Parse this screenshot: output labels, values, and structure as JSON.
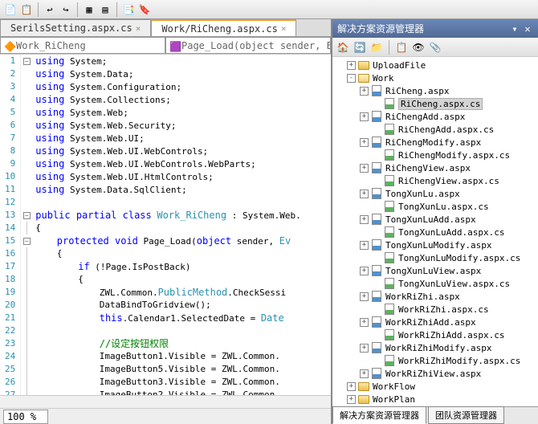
{
  "tabs": [
    {
      "label": "SerilsSetting.aspx.cs",
      "active": false
    },
    {
      "label": "Work/RiCheng.aspx.cs",
      "active": true
    }
  ],
  "dropdowns": {
    "left": "Work_RiCheng",
    "right": "Page_Load(object sender, Ev"
  },
  "code": [
    {
      "n": 1,
      "fold": "minus",
      "html": "<span class='kw'>using</span> System;"
    },
    {
      "n": 2,
      "fold": "",
      "html": "<span class='kw'>using</span> System.Data;"
    },
    {
      "n": 3,
      "fold": "",
      "html": "<span class='kw'>using</span> System.Configuration;"
    },
    {
      "n": 4,
      "fold": "",
      "html": "<span class='kw'>using</span> System.Collections;"
    },
    {
      "n": 5,
      "fold": "",
      "html": "<span class='kw'>using</span> System.Web;"
    },
    {
      "n": 6,
      "fold": "",
      "html": "<span class='kw'>using</span> System.Web.Security;"
    },
    {
      "n": 7,
      "fold": "",
      "html": "<span class='kw'>using</span> System.Web.UI;"
    },
    {
      "n": 8,
      "fold": "",
      "html": "<span class='kw'>using</span> System.Web.UI.WebControls;"
    },
    {
      "n": 9,
      "fold": "",
      "html": "<span class='kw'>using</span> System.Web.UI.WebControls.WebParts;"
    },
    {
      "n": 10,
      "fold": "",
      "html": "<span class='kw'>using</span> System.Web.UI.HtmlControls;"
    },
    {
      "n": 11,
      "fold": "",
      "html": "<span class='kw'>using</span> System.Data.SqlClient;"
    },
    {
      "n": 12,
      "fold": "",
      "html": ""
    },
    {
      "n": 13,
      "fold": "minus",
      "html": "<span class='kw'>public partial class</span> <span class='typ'>Work_RiCheng</span> : System.Web."
    },
    {
      "n": 14,
      "fold": "line",
      "html": "{"
    },
    {
      "n": 15,
      "fold": "minus",
      "html": "    <span class='kw'>protected void</span> Page_Load(<span class='kw'>object</span> sender, <span class='typ'>Ev</span>"
    },
    {
      "n": 16,
      "fold": "line",
      "html": "    {"
    },
    {
      "n": 17,
      "fold": "line",
      "html": "        <span class='kw'>if</span> (!Page.IsPostBack)"
    },
    {
      "n": 18,
      "fold": "line",
      "html": "        {"
    },
    {
      "n": 19,
      "fold": "line",
      "html": "            ZWL.Common.<span class='typ'>PublicMethod</span>.CheckSessi"
    },
    {
      "n": 20,
      "fold": "line",
      "html": "            DataBindToGridview();"
    },
    {
      "n": 21,
      "fold": "line",
      "html": "            <span class='kw'>this</span>.Calendar1.SelectedDate = <span class='typ'>Date</span>"
    },
    {
      "n": 22,
      "fold": "line",
      "html": ""
    },
    {
      "n": 23,
      "fold": "line",
      "html": "            <span class='cmt'>//设定按钮权限</span>"
    },
    {
      "n": 24,
      "fold": "line",
      "html": "            ImageButton1.Visible = ZWL.Common."
    },
    {
      "n": 25,
      "fold": "line",
      "html": "            ImageButton5.Visible = ZWL.Common."
    },
    {
      "n": 26,
      "fold": "line",
      "html": "            ImageButton3.Visible = ZWL.Common."
    },
    {
      "n": 27,
      "fold": "line",
      "html": "            ImageButton2.Visible = ZWL.Common."
    }
  ],
  "zoom": "100 %",
  "solution": {
    "title": "解决方案资源管理器",
    "tree": [
      {
        "indent": 1,
        "exp": "+",
        "icon": "folder",
        "label": "UploadFile"
      },
      {
        "indent": 1,
        "exp": "-",
        "icon": "folder-open",
        "label": "Work"
      },
      {
        "indent": 2,
        "exp": "+",
        "icon": "aspx",
        "label": "RiCheng.aspx"
      },
      {
        "indent": 3,
        "exp": "",
        "icon": "cs",
        "label": "RiCheng.aspx.cs",
        "selected": true
      },
      {
        "indent": 2,
        "exp": "+",
        "icon": "aspx",
        "label": "RiChengAdd.aspx"
      },
      {
        "indent": 3,
        "exp": "",
        "icon": "cs",
        "label": "RiChengAdd.aspx.cs"
      },
      {
        "indent": 2,
        "exp": "+",
        "icon": "aspx",
        "label": "RiChengModify.aspx"
      },
      {
        "indent": 3,
        "exp": "",
        "icon": "cs",
        "label": "RiChengModify.aspx.cs"
      },
      {
        "indent": 2,
        "exp": "+",
        "icon": "aspx",
        "label": "RiChengView.aspx"
      },
      {
        "indent": 3,
        "exp": "",
        "icon": "cs",
        "label": "RiChengView.aspx.cs"
      },
      {
        "indent": 2,
        "exp": "+",
        "icon": "aspx",
        "label": "TongXunLu.aspx"
      },
      {
        "indent": 3,
        "exp": "",
        "icon": "cs",
        "label": "TongXunLu.aspx.cs"
      },
      {
        "indent": 2,
        "exp": "+",
        "icon": "aspx",
        "label": "TongXunLuAdd.aspx"
      },
      {
        "indent": 3,
        "exp": "",
        "icon": "cs",
        "label": "TongXunLuAdd.aspx.cs"
      },
      {
        "indent": 2,
        "exp": "+",
        "icon": "aspx",
        "label": "TongXunLuModify.aspx"
      },
      {
        "indent": 3,
        "exp": "",
        "icon": "cs",
        "label": "TongXunLuModify.aspx.cs"
      },
      {
        "indent": 2,
        "exp": "+",
        "icon": "aspx",
        "label": "TongXunLuView.aspx"
      },
      {
        "indent": 3,
        "exp": "",
        "icon": "cs",
        "label": "TongXunLuView.aspx.cs"
      },
      {
        "indent": 2,
        "exp": "+",
        "icon": "aspx",
        "label": "WorkRiZhi.aspx"
      },
      {
        "indent": 3,
        "exp": "",
        "icon": "cs",
        "label": "WorkRiZhi.aspx.cs"
      },
      {
        "indent": 2,
        "exp": "+",
        "icon": "aspx",
        "label": "WorkRiZhiAdd.aspx"
      },
      {
        "indent": 3,
        "exp": "",
        "icon": "cs",
        "label": "WorkRiZhiAdd.aspx.cs"
      },
      {
        "indent": 2,
        "exp": "+",
        "icon": "aspx",
        "label": "WorkRiZhiModify.aspx"
      },
      {
        "indent": 3,
        "exp": "",
        "icon": "cs",
        "label": "WorkRiZhiModify.aspx.cs"
      },
      {
        "indent": 2,
        "exp": "+",
        "icon": "aspx",
        "label": "WorkRiZhiView.aspx"
      },
      {
        "indent": 1,
        "exp": "+",
        "icon": "folder",
        "label": "WorkFlow"
      },
      {
        "indent": 1,
        "exp": "+",
        "icon": "folder",
        "label": "WorkPlan"
      }
    ]
  },
  "bottom_tabs": [
    {
      "label": "解决方案资源管理器",
      "active": true
    },
    {
      "label": "团队资源管理器",
      "active": false
    }
  ]
}
